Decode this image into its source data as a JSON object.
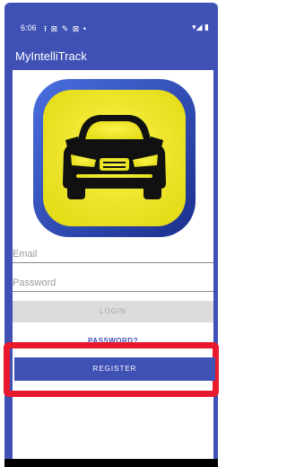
{
  "status_bar": {
    "time": "6:06",
    "notification_icons": "⭱ ⊠ ✎ ⊠ •",
    "right_icons": "▾◢ ▮"
  },
  "app_bar": {
    "title": "MyIntelliTrack"
  },
  "logo": {
    "icon": "car-icon",
    "background_color": "#f2ea2a",
    "border_color": "#2b49b8"
  },
  "form": {
    "email_placeholder": "Email",
    "password_placeholder": "Password",
    "login_label": "LOGIN",
    "forgot_label": "PASSWORD?",
    "register_label": "REGISTER"
  },
  "colors": {
    "primary": "#3f51b5",
    "highlight": "#e8192c"
  }
}
